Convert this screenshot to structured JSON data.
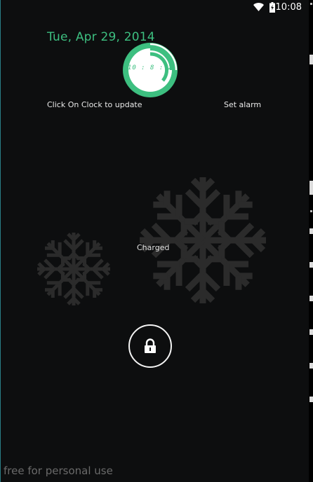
{
  "status_bar": {
    "time": "10:08",
    "wifi_icon": "wifi-icon",
    "battery_icon": "battery-charging-icon"
  },
  "lockscreen": {
    "date": "Tue, Apr 29, 2014",
    "clock_time": "10 : 8 : 2",
    "clock_hint": "Click On Clock to update",
    "set_alarm_label": "Set alarm",
    "battery_status": "Charged",
    "lock_icon": "lock-icon",
    "watermark": "free for personal use"
  },
  "colors": {
    "accent": "#3dbf80",
    "background": "#0d0e0f",
    "snowflake": "#2b2b2b"
  }
}
